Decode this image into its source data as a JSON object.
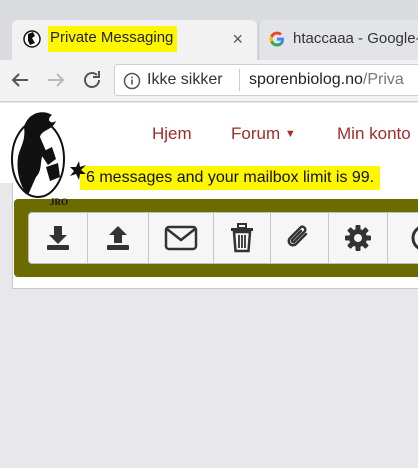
{
  "browser": {
    "tabs": [
      {
        "title": "Private Messaging",
        "active": true,
        "close_glyph": "×"
      },
      {
        "title": "htaccaaa - Google-",
        "active": false
      }
    ],
    "address_bar": {
      "security_label": "Ikke sikker",
      "url_host": "sporenbiolog.no",
      "url_path": "/Priva"
    }
  },
  "site": {
    "logo_text": "JRO",
    "nav": [
      {
        "label": "Hjem"
      },
      {
        "label": "Forum"
      },
      {
        "label": "Min konto"
      }
    ],
    "mailbox_notice": "6 messages and your mailbox limit is 99.",
    "toolbar_buttons": [
      {
        "icon": "download-icon"
      },
      {
        "icon": "upload-icon"
      },
      {
        "icon": "envelope-icon"
      },
      {
        "icon": "trash-icon"
      },
      {
        "icon": "paperclip-icon"
      },
      {
        "icon": "gear-icon"
      },
      {
        "icon": "clock-icon"
      }
    ]
  },
  "colors": {
    "nav_link": "#a02c2c",
    "highlight": "#fff700",
    "toolbar_band": "#6b6b00",
    "icon": "#333333"
  }
}
